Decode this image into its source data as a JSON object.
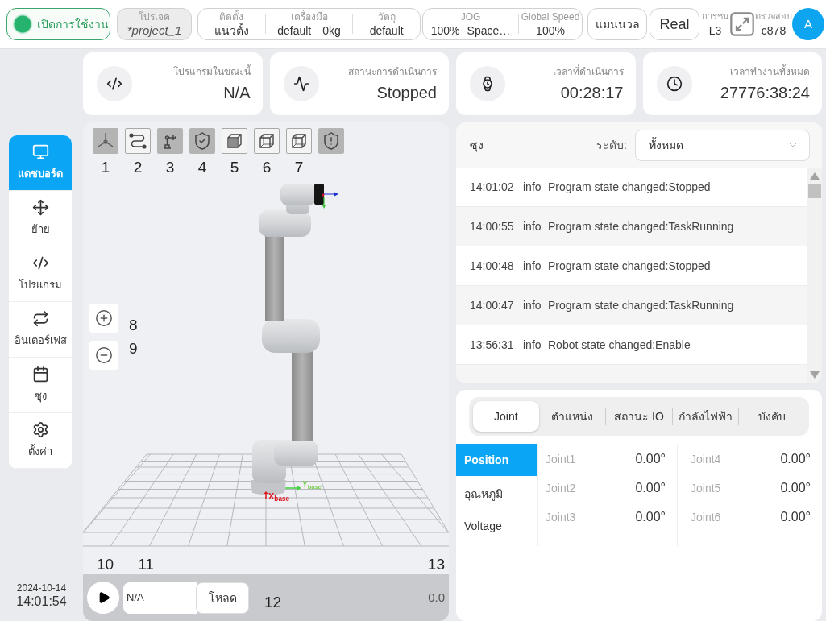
{
  "top_bar": {
    "enable_button": {
      "label": "เปิดการใช้งาน",
      "on": true
    },
    "project": {
      "label": "โปรเจค",
      "value": "*project_1"
    },
    "setup": [
      {
        "label": "ติดตั้ง",
        "value": "แนวตั้ง"
      },
      {
        "label": "เครื่องมือ",
        "value": "default",
        "extra": "0kg"
      },
      {
        "label": "วัตถุ",
        "value": "default"
      }
    ],
    "motion": [
      {
        "label": "JOG",
        "value": "100%",
        "extra": "Space…"
      },
      {
        "label": "Global Speed",
        "value": "100%"
      }
    ],
    "mode_buttons": [
      "แมนนวล",
      "Real"
    ],
    "collision": {
      "label": "การชน",
      "value": "L3"
    },
    "check": {
      "label": "ตรวจสอบ",
      "value": "c878"
    },
    "avatar": "A"
  },
  "stats": [
    {
      "kind": "code",
      "label": "โปรแกรมในขณะนี้",
      "value": "N/A"
    },
    {
      "kind": "activity",
      "label": "สถานะการดำเนินการ",
      "value": "Stopped"
    },
    {
      "kind": "watch",
      "label": "เวลาที่ดำเนินการ",
      "value": "00:28:17"
    },
    {
      "kind": "clock",
      "label": "เวลาทำงานทั้งหมด",
      "value": "27776:38:24"
    }
  ],
  "sidebar": {
    "items": [
      {
        "kind": "monitor",
        "label": "แดชบอร์ด",
        "selected": true
      },
      {
        "kind": "move",
        "label": "ย้าย",
        "selected": false
      },
      {
        "kind": "code",
        "label": "โปรแกรม",
        "selected": false
      },
      {
        "kind": "repeat",
        "label": "อินเตอร์เฟส",
        "selected": false
      },
      {
        "kind": "calendar",
        "label": "ซุง",
        "selected": false
      },
      {
        "kind": "settings",
        "label": "ตั้งค่า",
        "selected": false
      }
    ],
    "date": "2024-10-14",
    "time": "14:01:54"
  },
  "viewport": {
    "toolbar": [
      {
        "kind": "axes",
        "on": true,
        "callout": "1"
      },
      {
        "kind": "path",
        "on": false,
        "callout": "2"
      },
      {
        "kind": "robot",
        "on": true,
        "callout": "3"
      },
      {
        "kind": "shield-check",
        "on": true,
        "callout": "4"
      },
      {
        "kind": "cube-solid",
        "on": false,
        "callout": "5"
      },
      {
        "kind": "cube-wire",
        "on": false,
        "callout": "6"
      },
      {
        "kind": "cube-wire",
        "on": false,
        "callout": "7"
      },
      {
        "kind": "shield-alert",
        "on": true
      }
    ],
    "zoom": [
      {
        "kind": "zoom-in",
        "callout": "8"
      },
      {
        "kind": "zoom-out",
        "callout": "9"
      }
    ],
    "axis_labels": [
      {
        "text": "Y$_{base}$",
        "color": "#7ccf52"
      },
      {
        "text": "X$_{base}$",
        "color": "#e0141e"
      }
    ],
    "callouts": [
      "10",
      "11",
      "13"
    ],
    "program": {
      "value": "N/A",
      "load_button": "โหลด",
      "callout": "12",
      "reading": "0.0"
    }
  },
  "log": {
    "title": "ซุง",
    "level_label": "ระดับ:",
    "level_value": "ทั้งหมด",
    "rows": [
      {
        "time": "14:01:02",
        "level": "info",
        "message": "Program state changed:Stopped"
      },
      {
        "time": "14:00:55",
        "level": "info",
        "message": "Program state changed:TaskRunning"
      },
      {
        "time": "14:00:48",
        "level": "info",
        "message": "Program state changed:Stopped"
      },
      {
        "time": "14:00:47",
        "level": "info",
        "message": "Program state changed:TaskRunning"
      },
      {
        "time": "13:56:31",
        "level": "info",
        "message": "Robot state changed:Enable"
      }
    ]
  },
  "joint_panel": {
    "tabs": [
      {
        "label": "Joint",
        "selected": true
      },
      {
        "label": "ตำแหน่ง",
        "selected": false
      },
      {
        "label": "สถานะ IO",
        "selected": false
      },
      {
        "label": "กำลังไฟฟ้า",
        "selected": false
      },
      {
        "label": "บังคับ",
        "selected": false
      }
    ],
    "categories": [
      {
        "label": "Position",
        "selected": true
      },
      {
        "label": "อุณหภูมิ",
        "selected": false
      },
      {
        "label": "Voltage",
        "selected": false
      }
    ],
    "columns": [
      [
        {
          "name": "Joint1",
          "value": "0.00°"
        },
        {
          "name": "Joint2",
          "value": "0.00°"
        },
        {
          "name": "Joint3",
          "value": "0.00°"
        }
      ],
      [
        {
          "name": "Joint4",
          "value": "0.00°"
        },
        {
          "name": "Joint5",
          "value": "0.00°"
        },
        {
          "name": "Joint6",
          "value": "0.00°"
        }
      ]
    ]
  }
}
